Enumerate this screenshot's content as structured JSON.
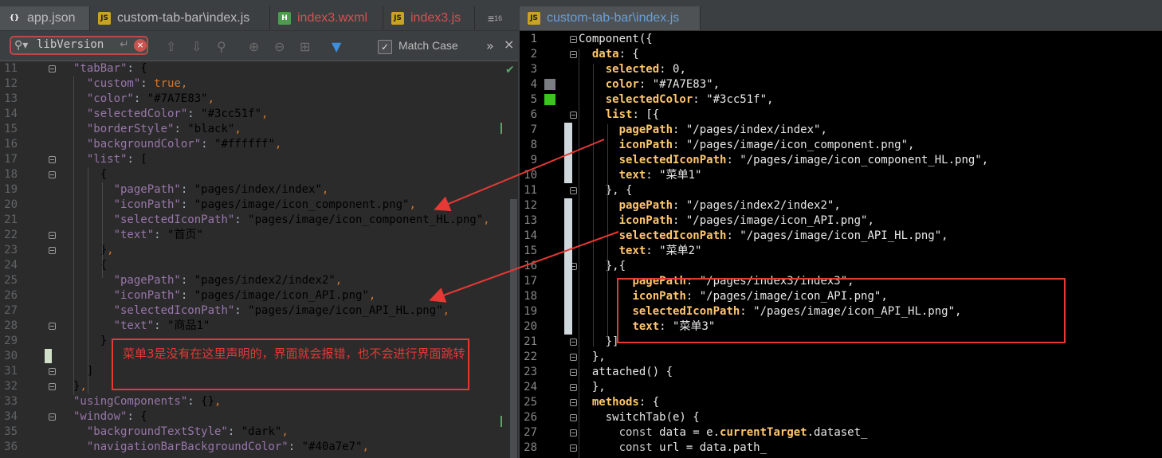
{
  "left_tabs": [
    {
      "label": "app.json",
      "icon": "{}"
    },
    {
      "label": "custom-tab-bar\\index.js",
      "icon": "JS"
    },
    {
      "label": "index3.wxml",
      "icon": "H"
    },
    {
      "label": "index3.js",
      "icon": "JS"
    }
  ],
  "tab_overflow": "≡",
  "tab_overflow_count": "16",
  "right_tab": {
    "label": "custom-tab-bar\\index.js",
    "icon": "JS"
  },
  "search": {
    "value": "libVersion",
    "match_case_label": "Match Case",
    "more": "»",
    "close": "×"
  },
  "annotation": {
    "text": "菜单3是没有在这里声明的，界面就会报错，也不会进行界面跳转",
    "color": "#e53935"
  },
  "colors": {
    "swatch_gray": "#7A7E83",
    "swatch_green": "#3cc51f"
  },
  "left_code": [
    {
      "n": "11",
      "t": "\"tabBar\": {"
    },
    {
      "n": "12",
      "t": "  \"custom\": true,"
    },
    {
      "n": "13",
      "t": "  \"color\": \"#7A7E83\","
    },
    {
      "n": "14",
      "t": "  \"selectedColor\": \"#3cc51f\","
    },
    {
      "n": "15",
      "t": "  \"borderStyle\": \"black\","
    },
    {
      "n": "16",
      "t": "  \"backgroundColor\": \"#ffffff\","
    },
    {
      "n": "17",
      "t": "  \"list\": ["
    },
    {
      "n": "18",
      "t": "    {"
    },
    {
      "n": "19",
      "t": "      \"pagePath\": \"pages/index/index\","
    },
    {
      "n": "20",
      "t": "      \"iconPath\": \"pages/image/icon_component.png\","
    },
    {
      "n": "21",
      "t": "      \"selectedIconPath\": \"pages/image/icon_component_HL.png\","
    },
    {
      "n": "22",
      "t": "      \"text\": \"首页\""
    },
    {
      "n": "23",
      "t": "    },"
    },
    {
      "n": "24",
      "t": "    {"
    },
    {
      "n": "25",
      "t": "      \"pagePath\": \"pages/index2/index2\","
    },
    {
      "n": "26",
      "t": "      \"iconPath\": \"pages/image/icon_API.png\","
    },
    {
      "n": "27",
      "t": "      \"selectedIconPath\": \"pages/image/icon_API_HL.png\","
    },
    {
      "n": "28",
      "t": "      \"text\": \"商品1\""
    },
    {
      "n": "29",
      "t": "    }"
    },
    {
      "n": "30",
      "t": ""
    },
    {
      "n": "31",
      "t": "  ]"
    },
    {
      "n": "32",
      "t": "},"
    },
    {
      "n": "33",
      "t": "\"usingComponents\": {},"
    },
    {
      "n": "34",
      "t": "\"window\": {"
    },
    {
      "n": "35",
      "t": "  \"backgroundTextStyle\": \"dark\","
    },
    {
      "n": "36",
      "t": "  \"navigationBarBackgroundColor\": \"#40a7e7\","
    }
  ],
  "right_code": [
    {
      "n": "1",
      "t": "Component({"
    },
    {
      "n": "2",
      "t": "  data: {"
    },
    {
      "n": "3",
      "t": "    selected: 0,"
    },
    {
      "n": "4",
      "t": "    color: \"#7A7E83\","
    },
    {
      "n": "5",
      "t": "    selectedColor: \"#3cc51f\","
    },
    {
      "n": "6",
      "t": "    list: [{"
    },
    {
      "n": "7",
      "t": "      pagePath: \"/pages/index/index\","
    },
    {
      "n": "8",
      "t": "      iconPath: \"/pages/image/icon_component.png\","
    },
    {
      "n": "9",
      "t": "      selectedIconPath: \"/pages/image/icon_component_HL.png\","
    },
    {
      "n": "10",
      "t": "      text: \"菜单1\""
    },
    {
      "n": "11",
      "t": "    }, {"
    },
    {
      "n": "12",
      "t": "      pagePath: \"/pages/index2/index2\","
    },
    {
      "n": "13",
      "t": "      iconPath: \"/pages/image/icon_API.png\","
    },
    {
      "n": "14",
      "t": "      selectedIconPath: \"/pages/image/icon_API_HL.png\","
    },
    {
      "n": "15",
      "t": "      text: \"菜单2\""
    },
    {
      "n": "16",
      "t": "    },{"
    },
    {
      "n": "17",
      "t": "        pagePath: \"/pages/index3/index3\","
    },
    {
      "n": "18",
      "t": "        iconPath: \"/pages/image/icon_API.png\","
    },
    {
      "n": "19",
      "t": "        selectedIconPath: \"/pages/image/icon_API_HL.png\","
    },
    {
      "n": "20",
      "t": "        text: \"菜单3\""
    },
    {
      "n": "21",
      "t": "    }]"
    },
    {
      "n": "22",
      "t": "  },"
    },
    {
      "n": "23",
      "t": "  attached() {"
    },
    {
      "n": "24",
      "t": "  },"
    },
    {
      "n": "25",
      "t": "  methods: {"
    },
    {
      "n": "26",
      "t": "    switchTab(e) {"
    },
    {
      "n": "27",
      "t": "      const data = e.currentTarget.dataset_"
    },
    {
      "n": "28",
      "t": "      const url = data.path_"
    }
  ]
}
